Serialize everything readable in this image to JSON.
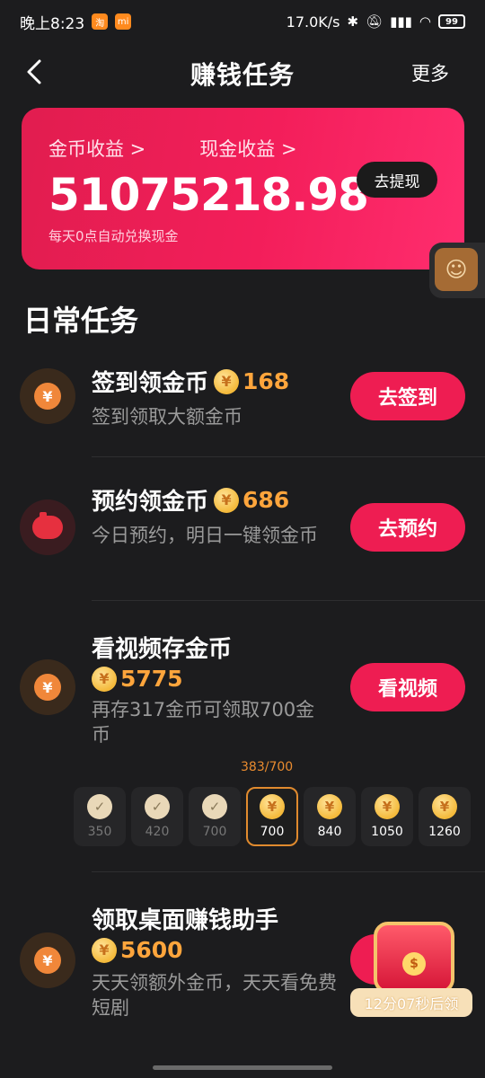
{
  "status_bar": {
    "time": "晚上8:23",
    "app_badge_1": "淘",
    "app_badge_2": "mi",
    "network_speed": "17.0K/s",
    "battery": "99"
  },
  "nav": {
    "title": "赚钱任务",
    "more": "更多"
  },
  "earnings": {
    "coin_label": "金币收益 >",
    "cash_label": "现金收益 >",
    "value": "51075218.98",
    "note": "每天0点自动兑换现金",
    "withdraw_button": "去提现"
  },
  "section": {
    "title": "日常任务"
  },
  "tasks": [
    {
      "title": "签到领金币",
      "reward": "168",
      "desc": "签到领取大额金币",
      "button": "去签到",
      "icon": "yen-coin-icon"
    },
    {
      "title": "预约领金币",
      "reward": "686",
      "desc": "今日预约，明日一键领金币",
      "button": "去预约",
      "icon": "piggy-bank-icon"
    },
    {
      "title": "看视频存金币",
      "reward": "5775",
      "desc": "再存317金币可领取700金币",
      "button": "看视频",
      "icon": "yen-coin-icon"
    },
    {
      "title": "领取桌面赚钱助手",
      "reward": "5600",
      "desc": "天天领额外金币，天天看免费短剧",
      "icon": "yen-coin-icon"
    }
  ],
  "progress": {
    "label": "383/700",
    "steps": [
      {
        "value": "350",
        "state": "done"
      },
      {
        "value": "420",
        "state": "done"
      },
      {
        "value": "700",
        "state": "done"
      },
      {
        "value": "700",
        "state": "active"
      },
      {
        "value": "840",
        "state": "future"
      },
      {
        "value": "1050",
        "state": "future"
      },
      {
        "value": "1260",
        "state": "future"
      }
    ]
  },
  "chest": {
    "timer": "12分07秒后领"
  },
  "colors": {
    "accent": "#ee1d52",
    "coin_orange": "#ffa53c",
    "background": "#1c1c1e"
  }
}
